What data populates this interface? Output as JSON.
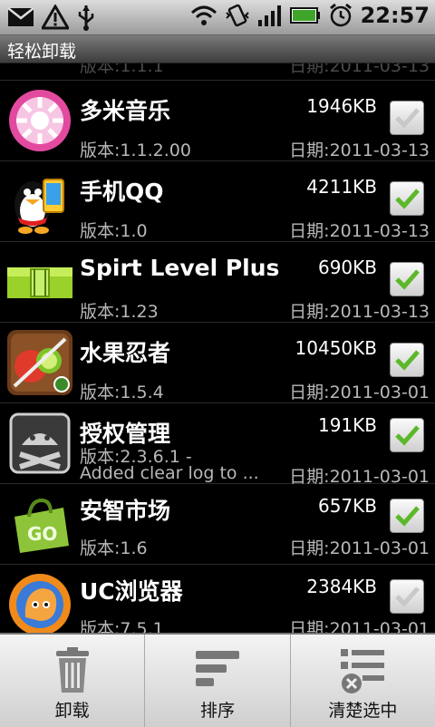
{
  "status": {
    "time": "22:57"
  },
  "title": "轻松卸载",
  "apps": [
    {
      "name": "",
      "size": "",
      "version": "版本:1.1.1",
      "date": "日期:2011-03-13",
      "checked": false,
      "partial": true
    },
    {
      "name": "多米音乐",
      "size": "1946KB",
      "version": "版本:1.1.2.00",
      "date": "日期:2011-03-13",
      "checked": false,
      "icon": "duomi-music-icon"
    },
    {
      "name": "手机QQ",
      "size": "4211KB",
      "version": "版本:1.0",
      "date": "日期:2011-03-13",
      "checked": true,
      "icon": "qq-penguin-icon"
    },
    {
      "name": "Spirt Level Plus",
      "size": "690KB",
      "version": "版本:1.23",
      "date": "日期:2011-03-13",
      "checked": true,
      "icon": "spirit-level-icon"
    },
    {
      "name": "水果忍者",
      "size": "10450KB",
      "version": "版本:1.5.4",
      "date": "日期:2011-03-01",
      "checked": true,
      "icon": "fruit-ninja-icon"
    },
    {
      "name": "授权管理",
      "size": "191KB",
      "version": "版本:2.3.6.1 -",
      "version2": "Added clear log to ...",
      "date": "日期:2011-03-01",
      "checked": true,
      "icon": "superuser-android-icon"
    },
    {
      "name": "安智市场",
      "size": "657KB",
      "version": "版本:1.6",
      "date": "日期:2011-03-01",
      "checked": true,
      "icon": "anzhi-market-bag-icon"
    },
    {
      "name": "UC浏览器",
      "size": "2384KB",
      "version": "版本:7.5.1",
      "date": "日期:2011-03-01",
      "checked": false,
      "icon": "uc-browser-squirrel-icon"
    }
  ],
  "menu": {
    "uninstall": "卸载",
    "sort": "排序",
    "clear": "清楚选中"
  },
  "colors": {
    "check_green": "#5cb82a",
    "check_gray": "#c8c8c8"
  }
}
